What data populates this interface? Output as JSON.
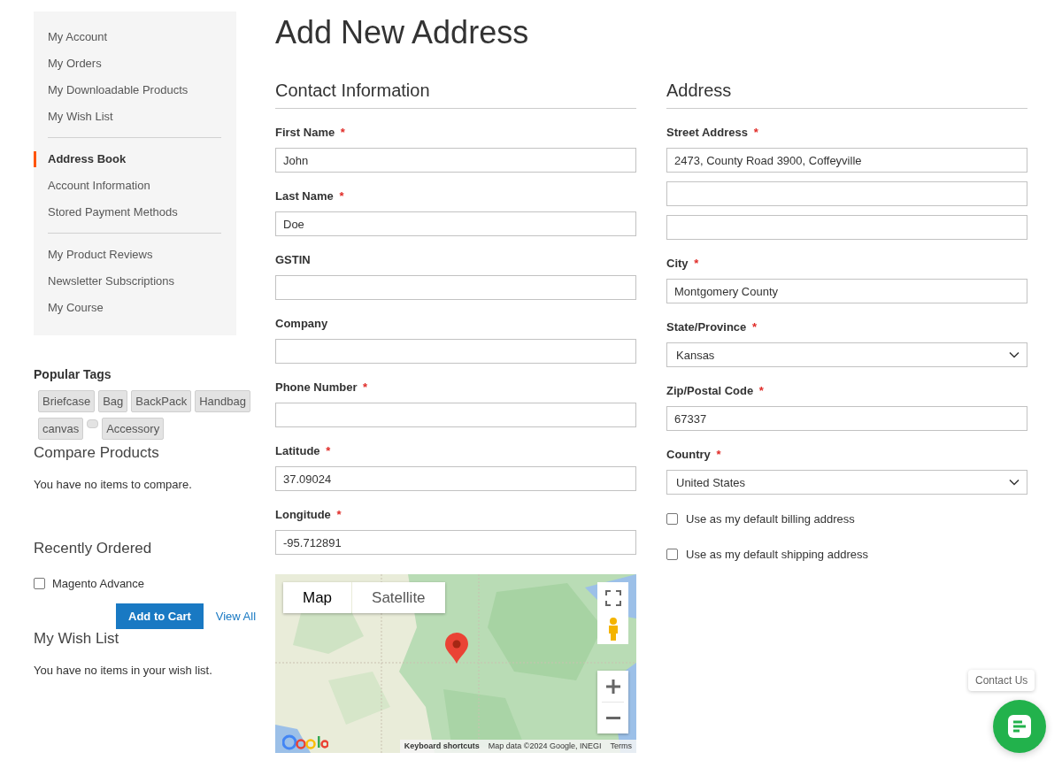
{
  "sidebar": {
    "nav_groups": [
      {
        "items": [
          {
            "label": "My Account",
            "selected": false
          },
          {
            "label": "My Orders",
            "selected": false
          },
          {
            "label": "My Downloadable Products",
            "selected": false
          },
          {
            "label": "My Wish List",
            "selected": false
          }
        ]
      },
      {
        "items": [
          {
            "label": "Address Book",
            "selected": true
          },
          {
            "label": "Account Information",
            "selected": false
          },
          {
            "label": "Stored Payment Methods",
            "selected": false
          }
        ]
      },
      {
        "items": [
          {
            "label": "My Product Reviews",
            "selected": false
          },
          {
            "label": "Newsletter Subscriptions",
            "selected": false
          },
          {
            "label": "My Course",
            "selected": false
          }
        ]
      }
    ],
    "popular_tags": {
      "title": "Popular Tags",
      "tags": [
        {
          "kind": "tag",
          "label": "Briefcase"
        },
        {
          "kind": "tag",
          "label": "Bag"
        },
        {
          "kind": "tag",
          "label": "BackPack"
        },
        {
          "kind": "tag",
          "label": "Handbag"
        },
        {
          "kind": "tag",
          "label": "canvas"
        },
        {
          "kind": "empty"
        },
        {
          "kind": "tag",
          "label": "Accessory"
        }
      ]
    },
    "compare_products": {
      "title": "Compare Products",
      "message": "You have no items to compare."
    },
    "recently_ordered": {
      "title": "Recently Ordered",
      "items": [
        {
          "label": "Magento Advance",
          "checked": false
        }
      ],
      "add_button": "Add to Cart",
      "view_all": "View All"
    },
    "wish_list": {
      "title": "My Wish List",
      "message": "You have no items in your wish list."
    }
  },
  "page_title": "Add New Address",
  "contact": {
    "title": "Contact Information",
    "fields": [
      {
        "kind": "text",
        "label": "First Name",
        "mark": "*",
        "value": "John"
      },
      {
        "kind": "text",
        "label": "Last Name",
        "mark": "*",
        "value": "Doe"
      },
      {
        "kind": "text",
        "label": "GSTIN"
      },
      {
        "kind": "text",
        "label": "Company"
      },
      {
        "kind": "text",
        "label": "Phone Number",
        "mark": "*"
      },
      {
        "kind": "text",
        "label": "Latitude",
        "mark": "*",
        "value": "37.09024"
      },
      {
        "kind": "text",
        "label": "Longitude",
        "mark": "*",
        "value": "-95.712891"
      }
    ],
    "map": {
      "map_types": [
        {
          "label": "Map",
          "selected": true
        },
        {
          "label": "Satellite",
          "selected": false
        }
      ],
      "attribution": {
        "shortcuts": "Keyboard shortcuts",
        "data": "Map data ©2024 Google, INEGI",
        "terms": "Terms"
      }
    }
  },
  "address": {
    "title": "Address",
    "fields": [
      {
        "kind": "multi",
        "label": "Street Address",
        "mark": "*",
        "lines": [
          {
            "kind": "filled",
            "value": "2473, County Road 3900, Coffeyville"
          },
          {
            "kind": "blank"
          },
          {
            "kind": "blank"
          }
        ]
      },
      {
        "kind": "text",
        "label": "City",
        "mark": "*",
        "value": "Montgomery County"
      },
      {
        "kind": "select",
        "label": "State/Province",
        "mark": "*",
        "value": "Kansas"
      },
      {
        "kind": "text",
        "label": "Zip/Postal Code",
        "mark": "*",
        "value": "67337"
      },
      {
        "kind": "select",
        "label": "Country",
        "mark": "*",
        "value": "United States"
      }
    ],
    "options": [
      {
        "label": "Use as my default billing address",
        "checked": false
      },
      {
        "label": "Use as my default shipping address",
        "checked": false
      }
    ]
  },
  "chat": {
    "tooltip": "Contact Us"
  }
}
